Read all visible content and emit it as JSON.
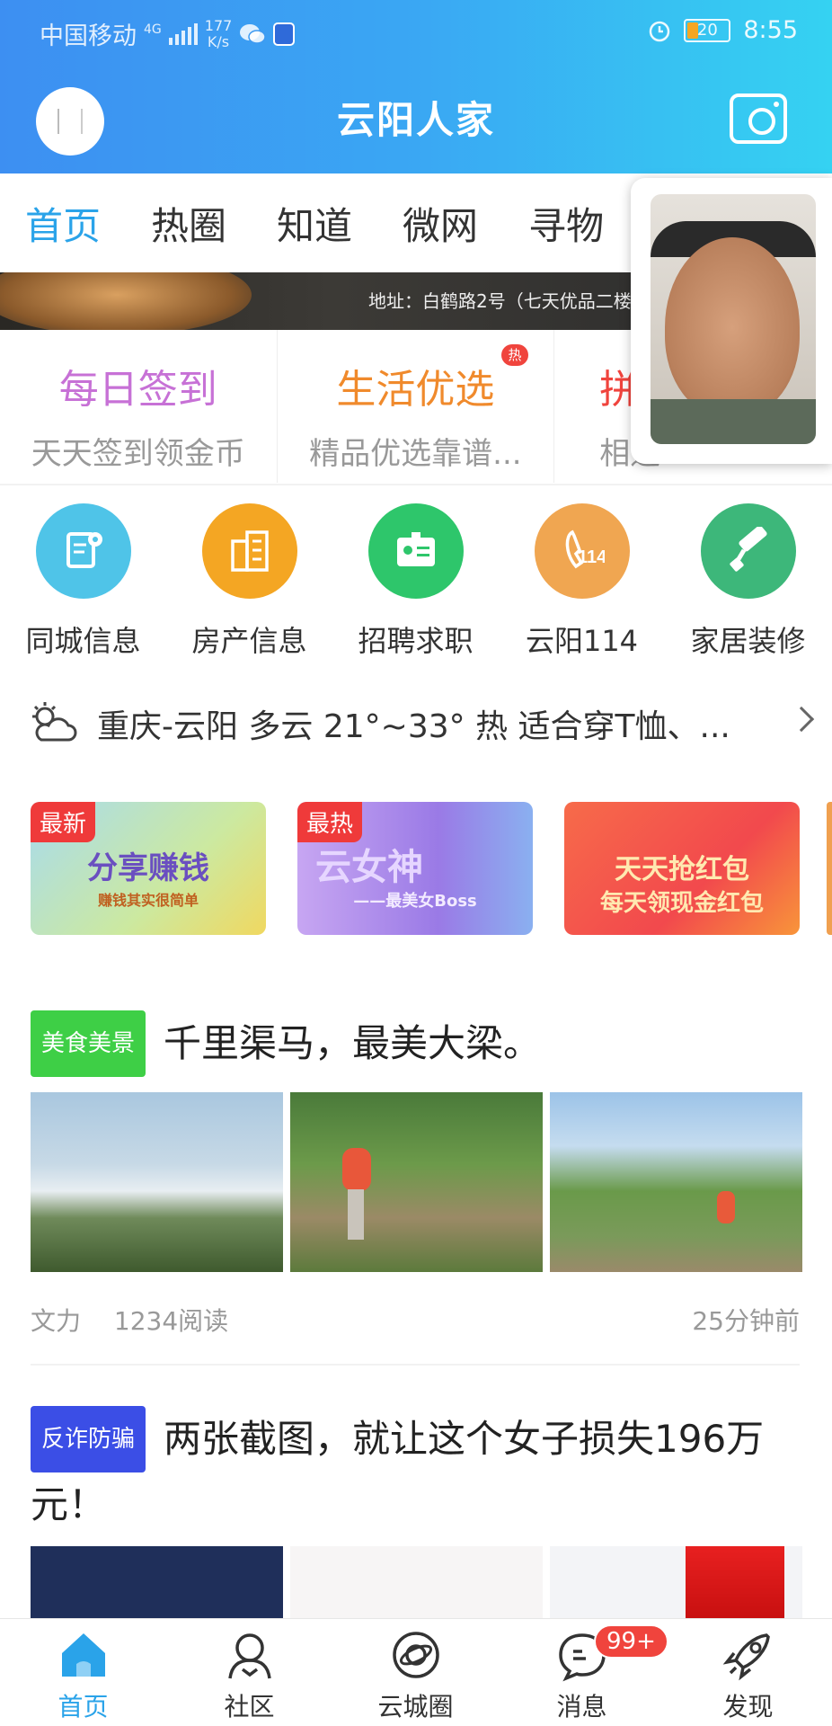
{
  "status_bar": {
    "carrier": "中国移动",
    "network": "4G",
    "speed_value": "177",
    "speed_unit": "K/s",
    "battery": "20",
    "time": "8:55"
  },
  "header": {
    "title": "云阳人家"
  },
  "tabs": [
    {
      "label": "首页",
      "active": true
    },
    {
      "label": "热圈"
    },
    {
      "label": "知道"
    },
    {
      "label": "微网"
    },
    {
      "label": "寻物"
    }
  ],
  "banner": {
    "address_text": "地址：白鹤路2号（七天优品二楼"
  },
  "quick_actions": [
    {
      "title": "每日签到",
      "subtitle": "天天签到领金币",
      "color": "#c771d6"
    },
    {
      "title": "生活优选",
      "subtitle": "精品优选靠谱...",
      "color": "#f08a2c",
      "badge": "热"
    },
    {
      "title": "拼",
      "subtitle": "相遇",
      "color": "#f0443d"
    }
  ],
  "services": [
    {
      "label": "同城信息",
      "icon": "document-location-icon",
      "color": "#4fc4e8"
    },
    {
      "label": "房产信息",
      "icon": "building-icon",
      "color": "#f4a623"
    },
    {
      "label": "招聘求职",
      "icon": "id-card-icon",
      "color": "#2ec66b"
    },
    {
      "label": "云阳114",
      "icon": "phone-114-icon",
      "color": "#f0a651"
    },
    {
      "label": "家居装修",
      "icon": "paint-roller-icon",
      "color": "#3db77a"
    }
  ],
  "weather": {
    "text": "重庆-云阳 多云 21°~33° 热 适合穿T恤、...",
    "icon": "cloudy-sun-icon"
  },
  "promos": [
    {
      "tag": "最新",
      "text": "分享赚钱",
      "sub": "赚钱其实很简单"
    },
    {
      "tag": "最热",
      "text": "云女神",
      "sub": "——最美女Boss"
    },
    {
      "text": "天天抢红包",
      "sub": "每天领现金红包"
    }
  ],
  "articles": [
    {
      "tag": "美食美景",
      "tag_color": "#3ecf46",
      "title": "千里渠马，最美大梁。",
      "author": "文力",
      "reads": "1234阅读",
      "time": "25分钟前"
    },
    {
      "tag": "反诈防骗",
      "tag_color": "#3b4ee6",
      "title": "两张截图，就让这个女子损失196万元！"
    }
  ],
  "bottom_nav": [
    {
      "label": "首页",
      "icon": "home-icon",
      "active": true
    },
    {
      "label": "社区",
      "icon": "community-icon"
    },
    {
      "label": "云城圈",
      "icon": "planet-icon"
    },
    {
      "label": "消息",
      "icon": "message-icon",
      "badge": "99+"
    },
    {
      "label": "发现",
      "icon": "rocket-icon"
    }
  ],
  "colors": {
    "accent": "#2aa3e9",
    "header_start": "#3d8ff2",
    "header_end": "#35d2f2"
  }
}
